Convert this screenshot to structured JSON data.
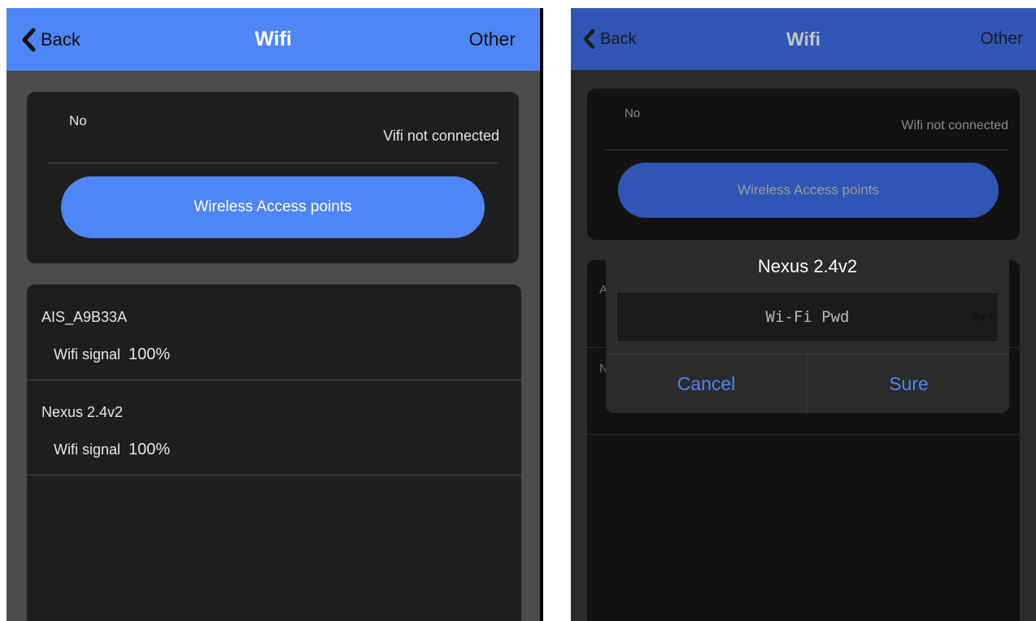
{
  "navbar": {
    "back_label": "Back",
    "title": "Wifi",
    "other_label": "Other"
  },
  "status": {
    "name": "No",
    "connection_text": "Wifi not connected",
    "clipped_connection_text": "Vifi not connected"
  },
  "access_points_button": "Wireless Access points",
  "networks": [
    {
      "name": "AIS_A9B33A",
      "signal_label": "Wifi signal",
      "signal_value": "100%"
    },
    {
      "name": "Nexus 2.4v2",
      "signal_label": "Wifi signal",
      "signal_value": "100%"
    }
  ],
  "dialog": {
    "title": "Nexus 2.4v2",
    "password_placeholder": "Wi-Fi Pwd",
    "password_value": "",
    "cancel_label": "Cancel",
    "sure_label": "Sure"
  },
  "peek": {
    "row1": "A",
    "row2": "N"
  },
  "colors": {
    "accent": "#4f86f7",
    "card": "#1e1e1e",
    "background": "#4c4c4c"
  },
  "icons": {
    "back": "chevron-left-icon",
    "eye": "eye-closed-icon"
  }
}
